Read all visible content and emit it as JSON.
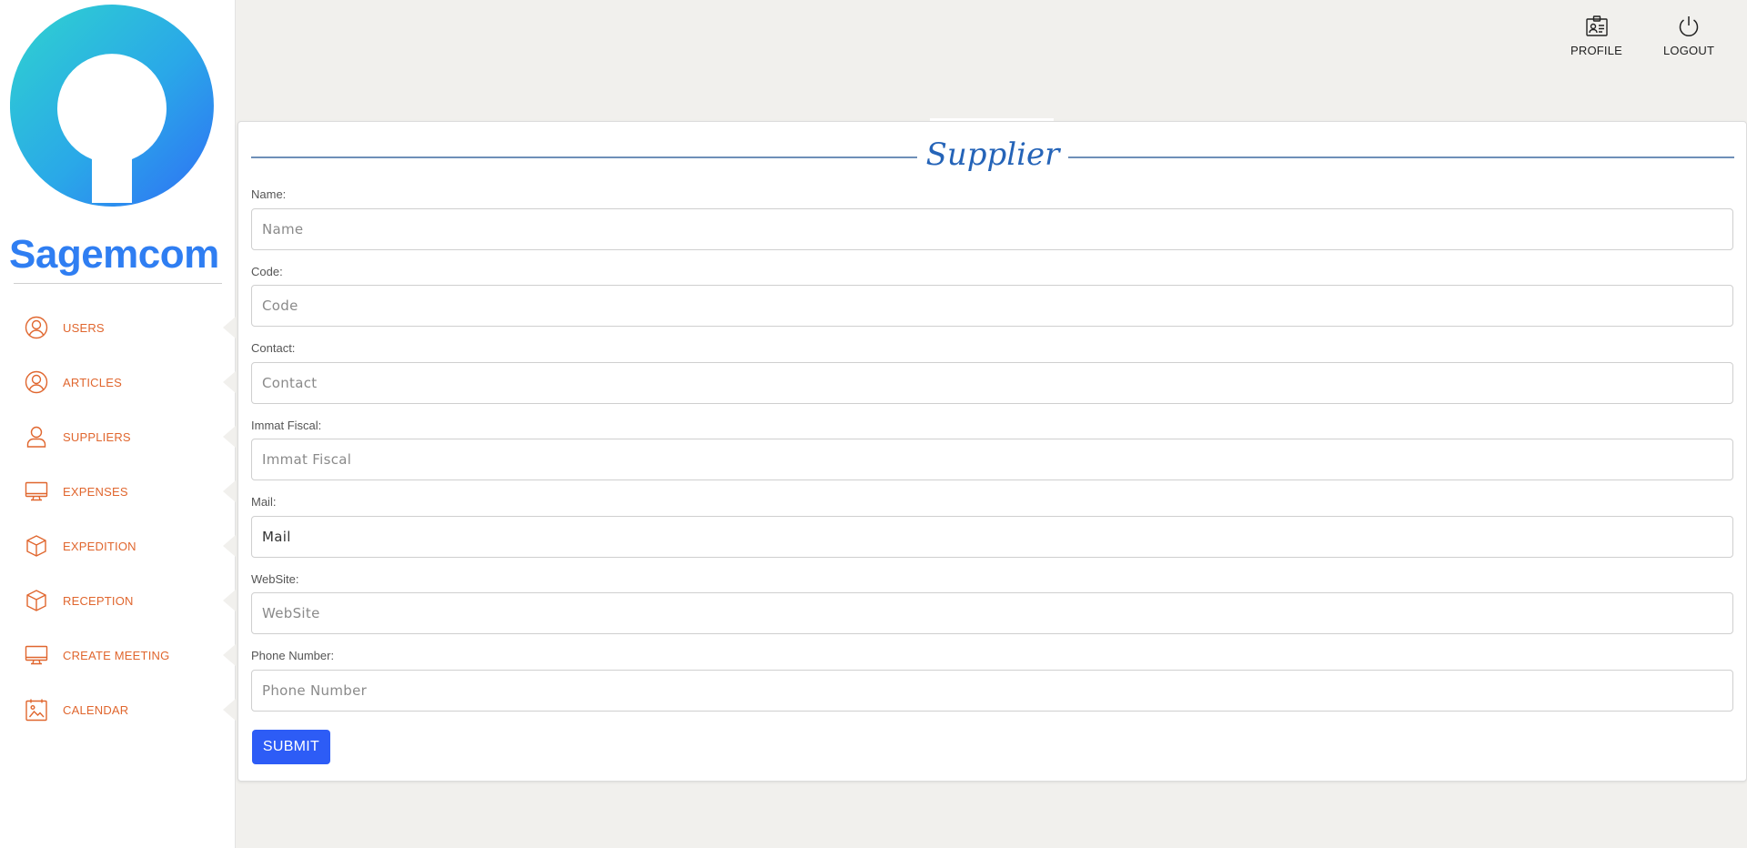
{
  "brand": {
    "name": "Sagemcom",
    "colors": {
      "primary": "#2f7ef2",
      "secondary": "#2fd3cf"
    }
  },
  "sidebar": {
    "accent_color": "#e0662e",
    "items": [
      {
        "label": "USERS",
        "icon": "user-circle-icon"
      },
      {
        "label": "ARTICLES",
        "icon": "user-circle-icon"
      },
      {
        "label": "SUPPLIERS",
        "icon": "user-icon"
      },
      {
        "label": "EXPENSES",
        "icon": "monitor-icon"
      },
      {
        "label": "EXPEDITION",
        "icon": "box-icon"
      },
      {
        "label": "RECEPTION",
        "icon": "box-icon"
      },
      {
        "label": "CREATE MEETING",
        "icon": "monitor-icon"
      },
      {
        "label": "CALENDAR",
        "icon": "calendar-image-icon"
      }
    ]
  },
  "topbar": {
    "profile": {
      "label": "PROFILE",
      "icon": "id-badge-icon"
    },
    "logout": {
      "label": "LOGOUT",
      "icon": "power-icon"
    }
  },
  "form": {
    "title": "Supplier",
    "fields": [
      {
        "label": "Name:",
        "placeholder": "Name",
        "value": ""
      },
      {
        "label": "Code:",
        "placeholder": "Code",
        "value": ""
      },
      {
        "label": "Contact:",
        "placeholder": "Contact",
        "value": ""
      },
      {
        "label": "Immat Fiscal:",
        "placeholder": "Immat Fiscal",
        "value": ""
      },
      {
        "label": "Mail:",
        "placeholder": "Mail",
        "value": ""
      },
      {
        "label": "WebSite:",
        "placeholder": "WebSite",
        "value": ""
      },
      {
        "label": "Phone Number:",
        "placeholder": "Phone Number",
        "value": ""
      }
    ],
    "submit_label": "SUBMIT",
    "submit_color": "#2d5cf6"
  }
}
